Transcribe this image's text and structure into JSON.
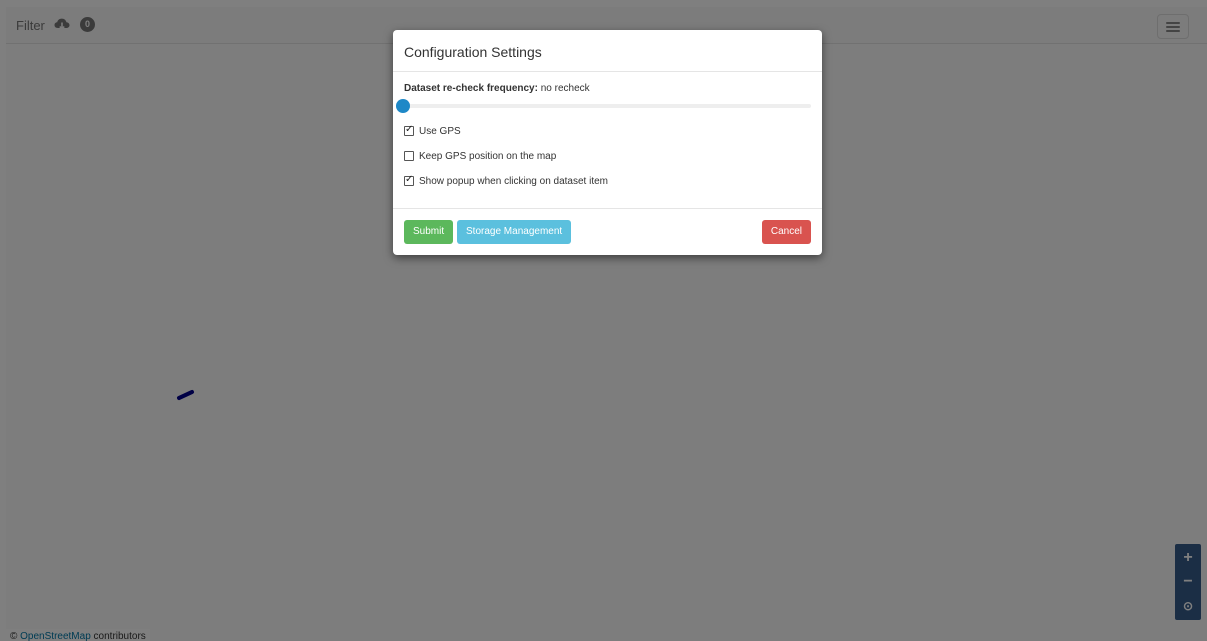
{
  "navbar": {
    "filter_label": "Filter",
    "filter_count": "0",
    "cloud_icon": "cloud-download-icon",
    "menu_icon": "hamburger-icon"
  },
  "map": {
    "attribution_prefix": "©",
    "attribution_link": "OpenStreetMap",
    "attribution_suffix": "contributors",
    "zoom_in": "+",
    "zoom_out": "−",
    "locate": "⊙"
  },
  "modal": {
    "title": "Configuration Settings",
    "frequency_label": "Dataset re-check frequency:",
    "frequency_value": "no recheck",
    "options": [
      {
        "label": "Use GPS",
        "checked": true
      },
      {
        "label": "Keep GPS position on the map",
        "checked": false
      },
      {
        "label": "Show popup when clicking on dataset item",
        "checked": true
      }
    ],
    "buttons": {
      "submit": "Submit",
      "storage": "Storage Management",
      "cancel": "Cancel"
    }
  },
  "colors": {
    "submit": "#5cb85c",
    "storage": "#5bc0de",
    "cancel": "#d9534f",
    "slider_handle": "#1e88c7",
    "zoom_control": "#365c8a",
    "track": "#00008b"
  }
}
